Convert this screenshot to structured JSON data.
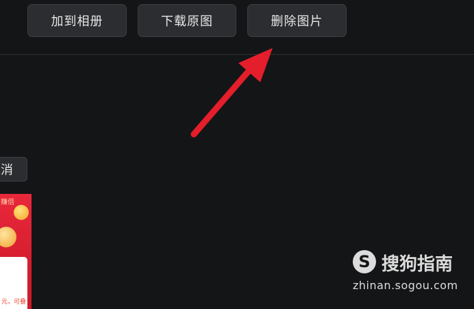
{
  "toolbar": {
    "add_to_album": "加到相册",
    "download_original": "下载原图",
    "delete_image": "删除图片"
  },
  "dialog": {
    "cancel_label": "取消"
  },
  "thumbnail": {
    "title_fragment": "赚倍",
    "card_text": "元，可叠"
  },
  "watermark": {
    "logo_letter": "S",
    "brand": "搜狗指南",
    "url": "zhinan.sogou.com"
  },
  "colors": {
    "background": "#141517",
    "button_bg": "#2c2d30",
    "arrow": "#e41e2b"
  }
}
